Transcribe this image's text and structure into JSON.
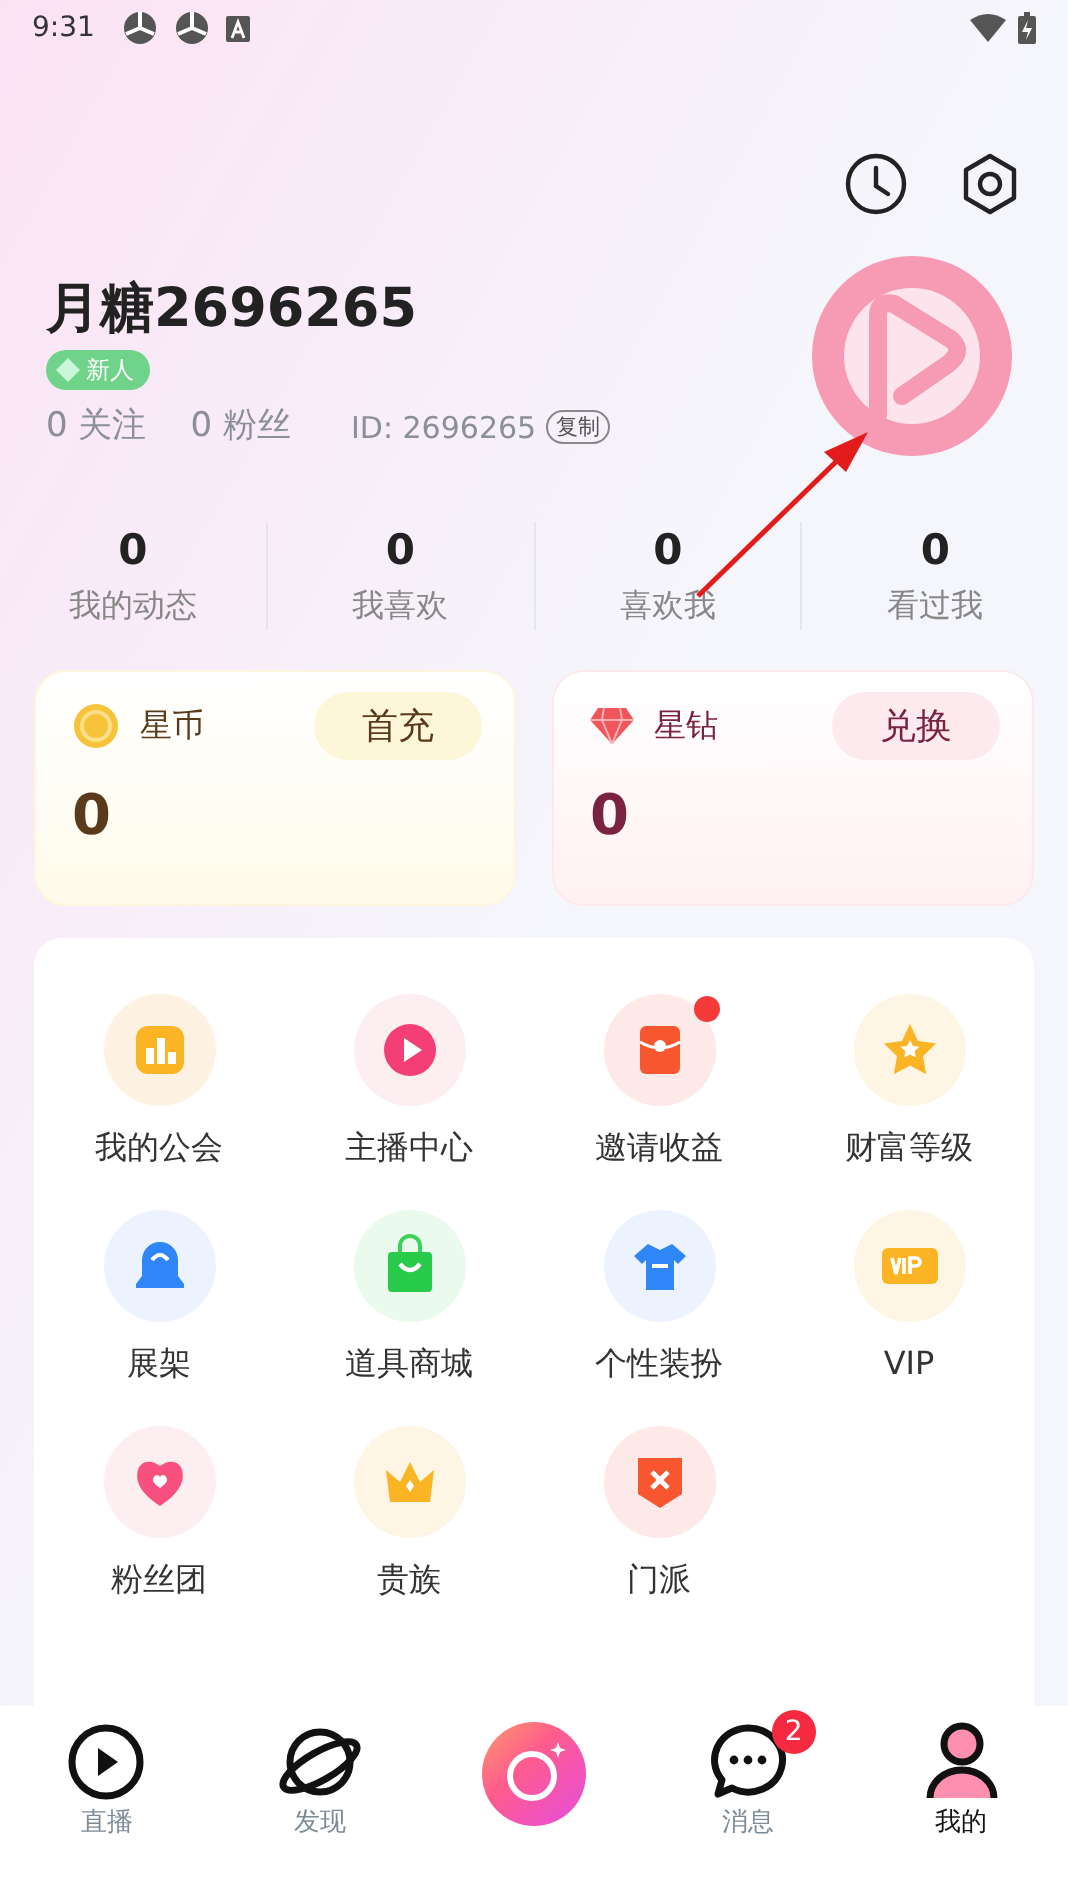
{
  "status_bar": {
    "time": "9:31"
  },
  "profile": {
    "name": "月糖2696265",
    "badge": "新人",
    "following": "0 关注",
    "fans": "0 粉丝",
    "id": "ID: 2696265",
    "copy": "复制"
  },
  "stats": [
    {
      "value": "0",
      "label": "我的动态"
    },
    {
      "value": "0",
      "label": "我喜欢"
    },
    {
      "value": "0",
      "label": "喜欢我"
    },
    {
      "value": "0",
      "label": "看过我"
    }
  ],
  "wallets": [
    {
      "kind": "coin",
      "name": "星币",
      "action": "首充",
      "value": "0"
    },
    {
      "kind": "diamond",
      "name": "星钻",
      "action": "兑换",
      "value": "0"
    }
  ],
  "menu": [
    {
      "label": "我的公会",
      "dot": false
    },
    {
      "label": "主播中心",
      "dot": false
    },
    {
      "label": "邀请收益",
      "dot": true
    },
    {
      "label": "财富等级",
      "dot": false
    },
    {
      "label": "展架",
      "dot": false
    },
    {
      "label": "道具商城",
      "dot": false
    },
    {
      "label": "个性装扮",
      "dot": false
    },
    {
      "label": "VIP",
      "dot": false
    },
    {
      "label": "粉丝团",
      "dot": false
    },
    {
      "label": "贵族",
      "dot": false
    },
    {
      "label": "门派",
      "dot": false
    }
  ],
  "bottom_nav": [
    {
      "kind": "tab",
      "label": "直播",
      "selected": false
    },
    {
      "kind": "tab",
      "label": "发现",
      "selected": false
    },
    {
      "kind": "camera"
    },
    {
      "kind": "tab",
      "label": "消息",
      "selected": false,
      "badge": "2"
    },
    {
      "kind": "tab",
      "label": "我的",
      "selected": true
    }
  ]
}
